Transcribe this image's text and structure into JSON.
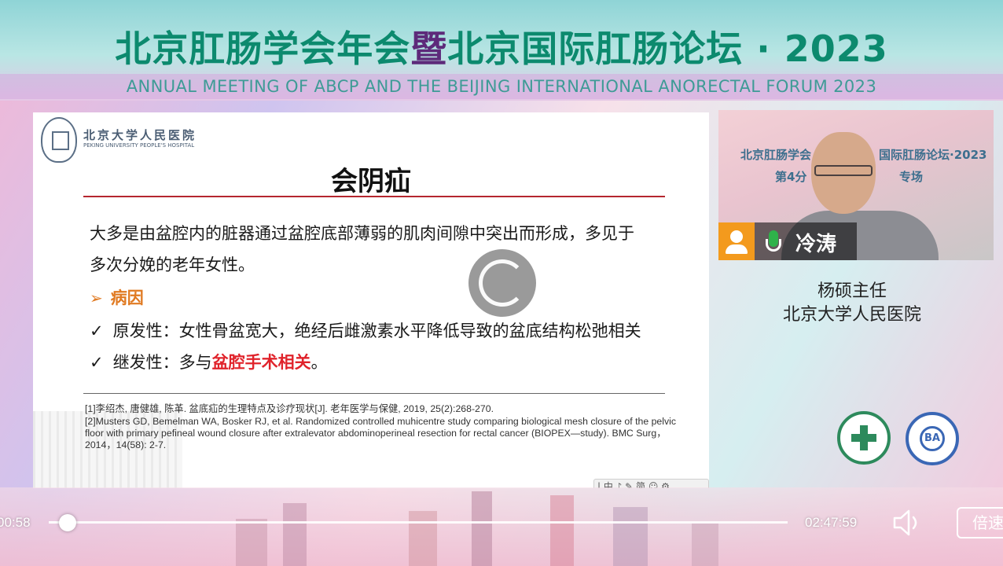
{
  "banner": {
    "title_part1": "北京肛肠学会年会",
    "title_accent": "暨",
    "title_part2": "北京国际肛肠论坛 · 2023",
    "subtitle": "ANNUAL MEETING OF ABCP AND THE BEIJING INTERNATIONAL ANORECTAL FORUM 2023"
  },
  "slide": {
    "hospital_cn": "北京大学人民医院",
    "hospital_en": "PEKING UNIVERSITY PEOPLE'S HOSPITAL",
    "title": "会阴疝",
    "line1": "大多是由盆腔内的脏器通过盆腔底部薄弱的肌肉间隙中突出而形成，多见于",
    "line2": "多次分娩的老年女性。",
    "cause_arrow": "➢",
    "cause_label": "病因",
    "check_mark": "✓",
    "point1": "原发性：女性骨盆宽大，绝经后雌激素水平降低导致的盆底结构松弛相关",
    "point2_prefix": "继发性：多与",
    "point2_highlight": "盆腔手术相关",
    "point2_suffix": "。",
    "ref1": "[1]李绍杰, 唐健雄, 陈革. 盆底疝的生理特点及诊疗现状[J]. 老年医学与保健, 2019, 25(2):268-270.",
    "ref2": "[2]Musters GD, Bemelman WA, Bosker RJ, et al. Randomized controlled muhicentre study comparing biological mesh closure of  the pelvic floor with primary pefineal wound closure after extralevator abdominoperineal resection for rectal cancer (BIOPEX—study). BMC Surg，2014，14(58): 2-7.",
    "toolbar": "| 中 ♪ ✎ 简 ☺ ⚙"
  },
  "cam": {
    "wall_line1": "北京肛肠学会",
    "wall_line2": "国际肛肠论坛·2023",
    "wall_line3": "第4分",
    "wall_line4": "专场",
    "name": "冷涛"
  },
  "speaker": {
    "name_title": "杨硕主任",
    "affiliation": "北京大学人民医院"
  },
  "logos": {
    "blue_text": "BA"
  },
  "player": {
    "current_time": "00:58",
    "total_time": "02:47:59",
    "progress": 0.006,
    "speed_label": "倍速"
  },
  "colors": {
    "banner_green": "#0c8a6e",
    "banner_purple": "#5d2a7a",
    "slide_red": "#e0232b",
    "slide_orange": "#e07a22"
  },
  "icons": [
    "user-icon",
    "microphone-icon",
    "volume-icon",
    "loading-spinner-icon"
  ]
}
